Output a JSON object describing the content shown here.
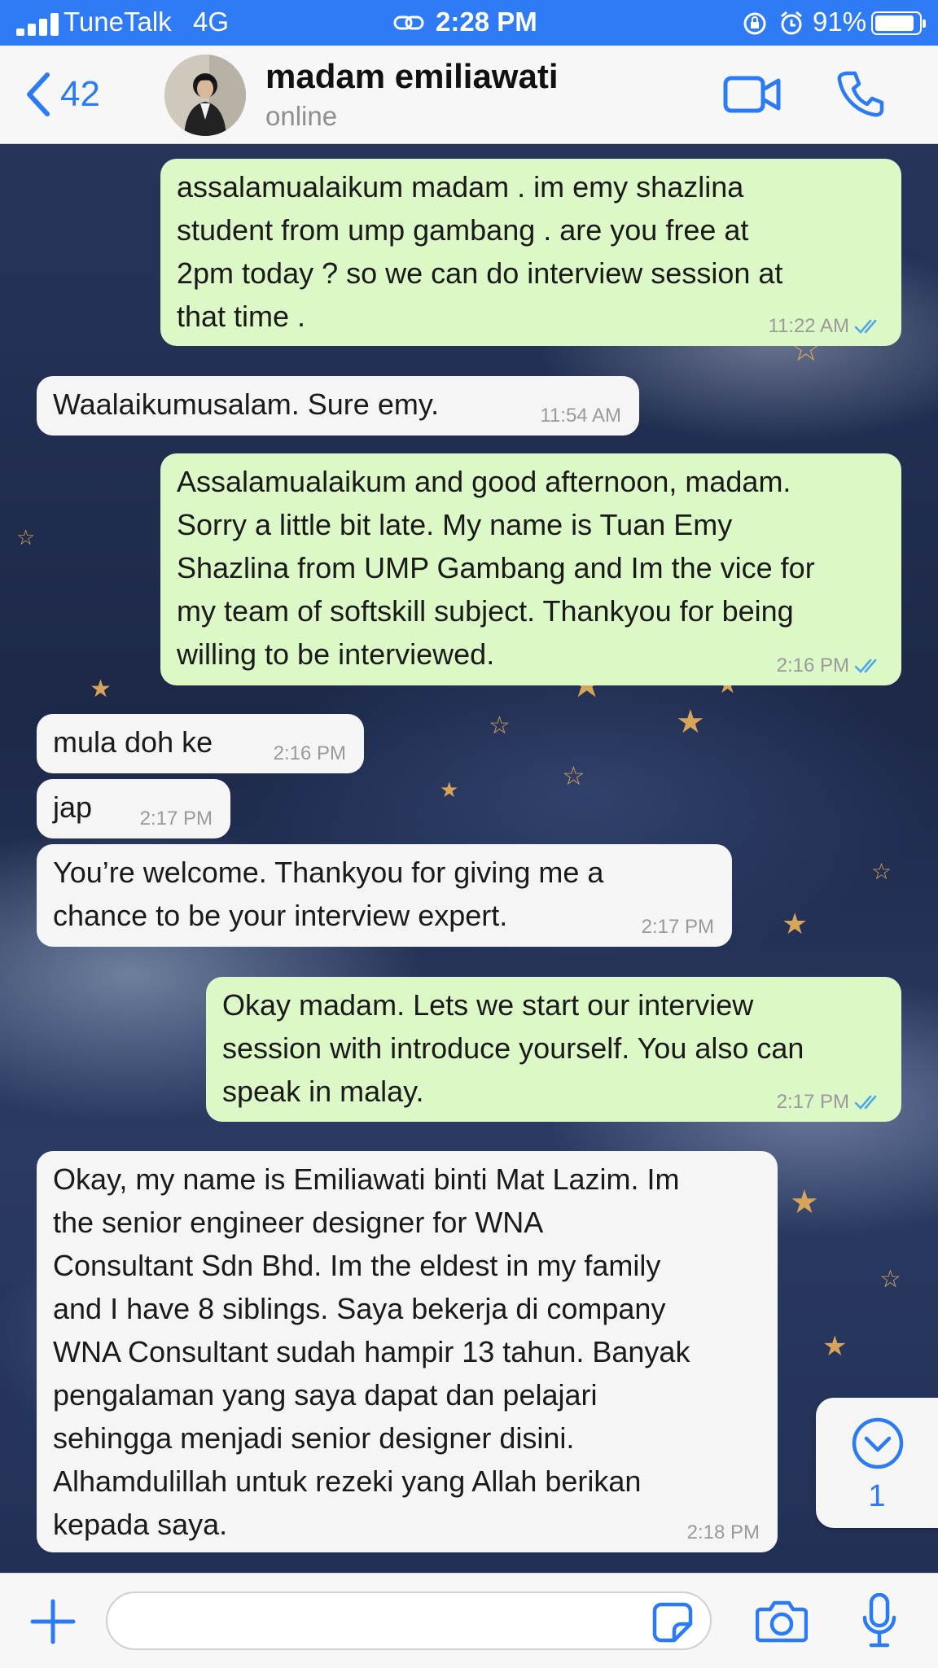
{
  "status_bar": {
    "carrier": "TuneTalk",
    "network": "4G",
    "time": "2:28 PM",
    "battery_percent": "91%",
    "battery_level": 0.91,
    "icons": [
      "signal-icon",
      "hotspot-link-icon",
      "orientation-lock-icon",
      "alarm-icon",
      "battery-icon"
    ]
  },
  "header": {
    "back_count": "42",
    "contact_name": "madam emiliawati",
    "presence": "online",
    "icons": [
      "back-chevron-icon",
      "video-call-icon",
      "phone-call-icon"
    ]
  },
  "messages": [
    {
      "direction": "out",
      "text": "assalamualaikum madam . im emy shazlina\nstudent from ump gambang . are you free at\n2pm today ? so we can do interview session at\nthat time .",
      "time": "11:22 AM",
      "read": true
    },
    {
      "direction": "in",
      "text": "Waalaikumusalam. Sure emy.",
      "time": "11:54 AM"
    },
    {
      "direction": "out",
      "text": "Assalamualaikum and good afternoon, madam.\nSorry a little bit late. My name is Tuan Emy\nShazlina from UMP Gambang and Im the vice for\nmy team of softskill subject. Thankyou for being\nwilling to be interviewed.",
      "time": "2:16 PM",
      "read": true
    },
    {
      "direction": "in",
      "text": "mula doh ke",
      "time": "2:16 PM"
    },
    {
      "direction": "in",
      "text": "jap",
      "time": "2:17 PM"
    },
    {
      "direction": "in",
      "text": "You’re welcome. Thankyou for giving me a\nchance to be your interview expert.",
      "time": "2:17 PM"
    },
    {
      "direction": "out",
      "text": "Okay madam. Lets we start our interview\nsession with introduce yourself. You also can\nspeak in malay.",
      "time": "2:17 PM",
      "read": true
    },
    {
      "direction": "in",
      "text": "Okay, my name is Emiliawati binti Mat Lazim. Im\nthe senior engineer designer for WNA\nConsultant Sdn Bhd. Im the eldest in my family\nand I have 8 siblings. Saya bekerja di company\nWNA Consultant sudah hampir 13 tahun. Banyak\npengalaman yang saya dapat dan pelajari\nsehingga menjadi senior designer disini.\nAlhamdulillah untuk rezeki yang Allah berikan\nkepada saya.",
      "time": "2:18 PM"
    }
  ],
  "scroll_to_bottom": {
    "unread": "1",
    "icon": "chevron-down-circle-icon"
  },
  "composer": {
    "value": "",
    "icons": [
      "plus-icon",
      "sticker-icon",
      "camera-icon",
      "microphone-icon"
    ]
  },
  "colors": {
    "status_bar": "#2f7bf6",
    "accent": "#2a7bf4",
    "outgoing_bubble": "#dcf8c6",
    "incoming_bubble": "#f5f5f5",
    "read_ticks": "#4fa8e8"
  }
}
